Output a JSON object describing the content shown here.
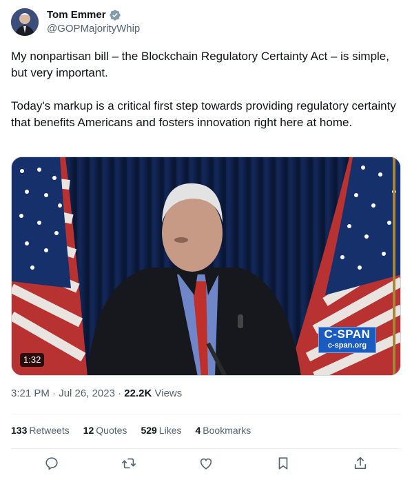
{
  "author": {
    "display_name": "Tom Emmer",
    "handle": "@GOPMajorityWhip",
    "verified": true,
    "verified_color": "#829aab"
  },
  "tweet": {
    "paragraph_1": "My nonpartisan bill – the Blockchain Regulatory Certainty Act – is simple, but very important.",
    "paragraph_2": "Today's markup is a critical first step towards providing regulatory certainty that benefits Americans and fosters innovation right here at home."
  },
  "media": {
    "duration": "1:32",
    "watermark_line1": "C-SPAN",
    "watermark_line2": "c-span.org"
  },
  "meta": {
    "time": "3:21 PM",
    "date": "Jul 26, 2023",
    "views_count": "22.2K",
    "views_label": "Views"
  },
  "stats": {
    "retweets_count": "133",
    "retweets_label": "Retweets",
    "quotes_count": "12",
    "quotes_label": "Quotes",
    "likes_count": "529",
    "likes_label": "Likes",
    "bookmarks_count": "4",
    "bookmarks_label": "Bookmarks"
  },
  "actions": [
    "reply-icon",
    "retweet-icon",
    "like-icon",
    "bookmark-icon",
    "share-icon"
  ],
  "colors": {
    "text": "#0f1419",
    "secondary": "#536471",
    "divider": "#eff3f4"
  }
}
